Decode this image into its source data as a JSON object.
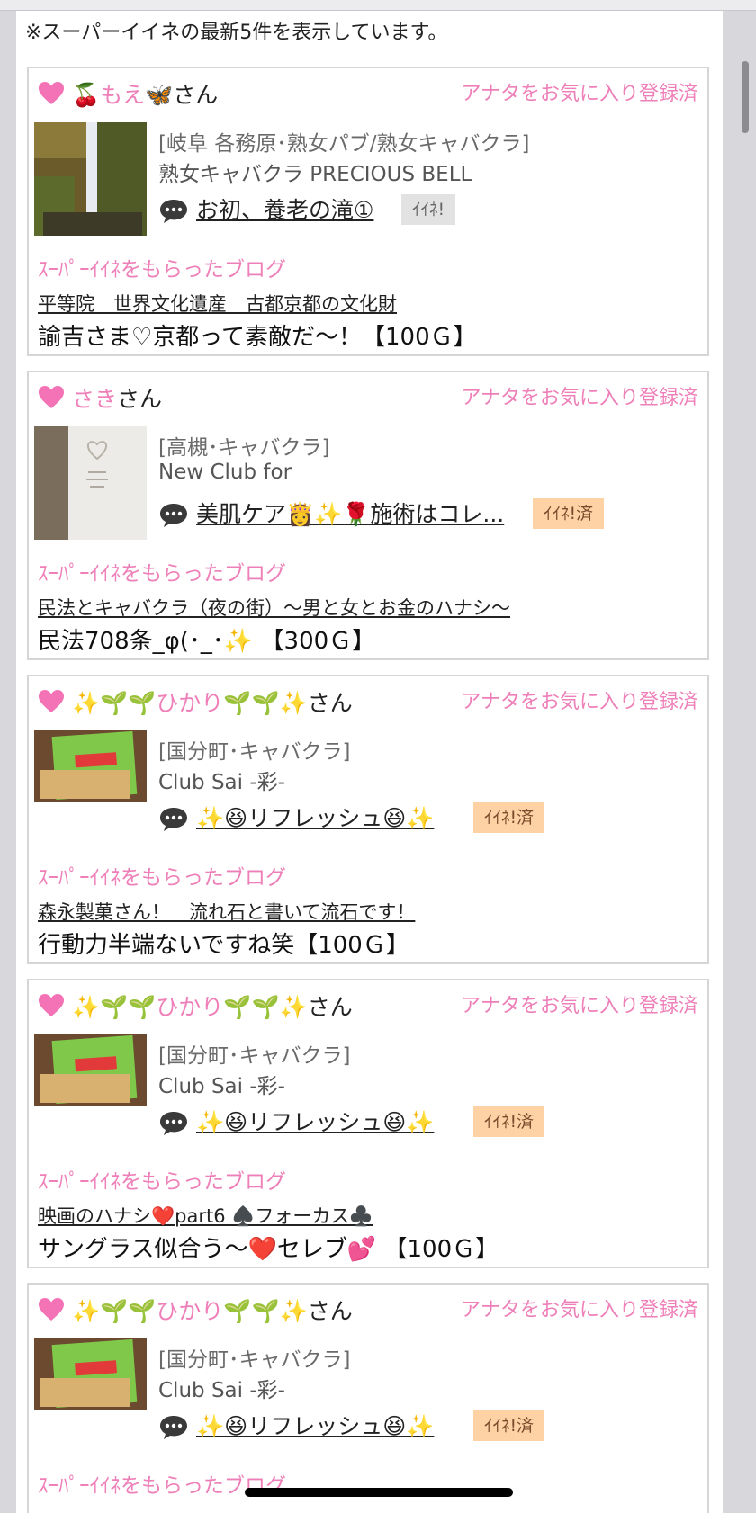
{
  "notice": "※スーパーイイネの最新5件を表示しています。",
  "labels": {
    "fav": "アナタをお気に入り登録済",
    "blog_head": "ｽｰﾊﾟｰｲｲﾈをもらったブログ",
    "iine": "ｲｲﾈ!",
    "iine_done": "ｲｲﾈ!済",
    "san": "さん"
  },
  "cards": [
    {
      "name": "🍒もえ🦋",
      "category": "[岐阜 各務原･熟女パブ/熟女キャバクラ]",
      "store": "熟女キャバクラ PRECIOUS BELL",
      "post_title": "お初、養老の滝①",
      "iine_state": "ｲｲﾈ!",
      "blog_link": "平等院　世界文化遺産　古都京都の文化財",
      "comment": "諭吉さま♡京都って素敵だ〜！【100Ｇ】"
    },
    {
      "name": "さき",
      "category": "[高槻･キャバクラ]",
      "store": "New Club for",
      "post_title": "美肌ケア👸✨🌹施術はコレ...",
      "iine_state": "ｲｲﾈ!済",
      "blog_link": "民法とキャバクラ（夜の街）〜男と女とお金のハナシ〜",
      "comment": "民法708条_φ(･_･✨ 【300Ｇ】"
    },
    {
      "name": "✨🌱🌱ひかり🌱🌱✨",
      "category": "[国分町･キャバクラ]",
      "store": "Club Sai -彩-",
      "post_title": "✨😆リフレッシュ😆✨",
      "iine_state": "ｲｲﾈ!済",
      "blog_link": "森永製菓さん！　流れ石と書いて流石です！",
      "comment": "行動力半端ないですね笑【100Ｇ】"
    },
    {
      "name": "✨🌱🌱ひかり🌱🌱✨",
      "category": "[国分町･キャバクラ]",
      "store": "Club Sai -彩-",
      "post_title": "✨😆リフレッシュ😆✨",
      "iine_state": "ｲｲﾈ!済",
      "blog_link": "映画のハナシ❤️part6 ♠️フォーカス♣️",
      "comment": "サングラス似合う〜❤️セレブ💕 【100Ｇ】"
    },
    {
      "name": "✨🌱🌱ひかり🌱🌱✨",
      "category": "[国分町･キャバクラ]",
      "store": "Club Sai -彩-",
      "post_title": "✨😆リフレッシュ😆✨",
      "iine_state": "ｲｲﾈ!済",
      "blog_link": "",
      "comment": ""
    }
  ],
  "colors": {
    "accent_pink": "#ee7fb8",
    "iine_done_bg": "#ffd2a6",
    "iine_bg": "#e2e2e2"
  }
}
